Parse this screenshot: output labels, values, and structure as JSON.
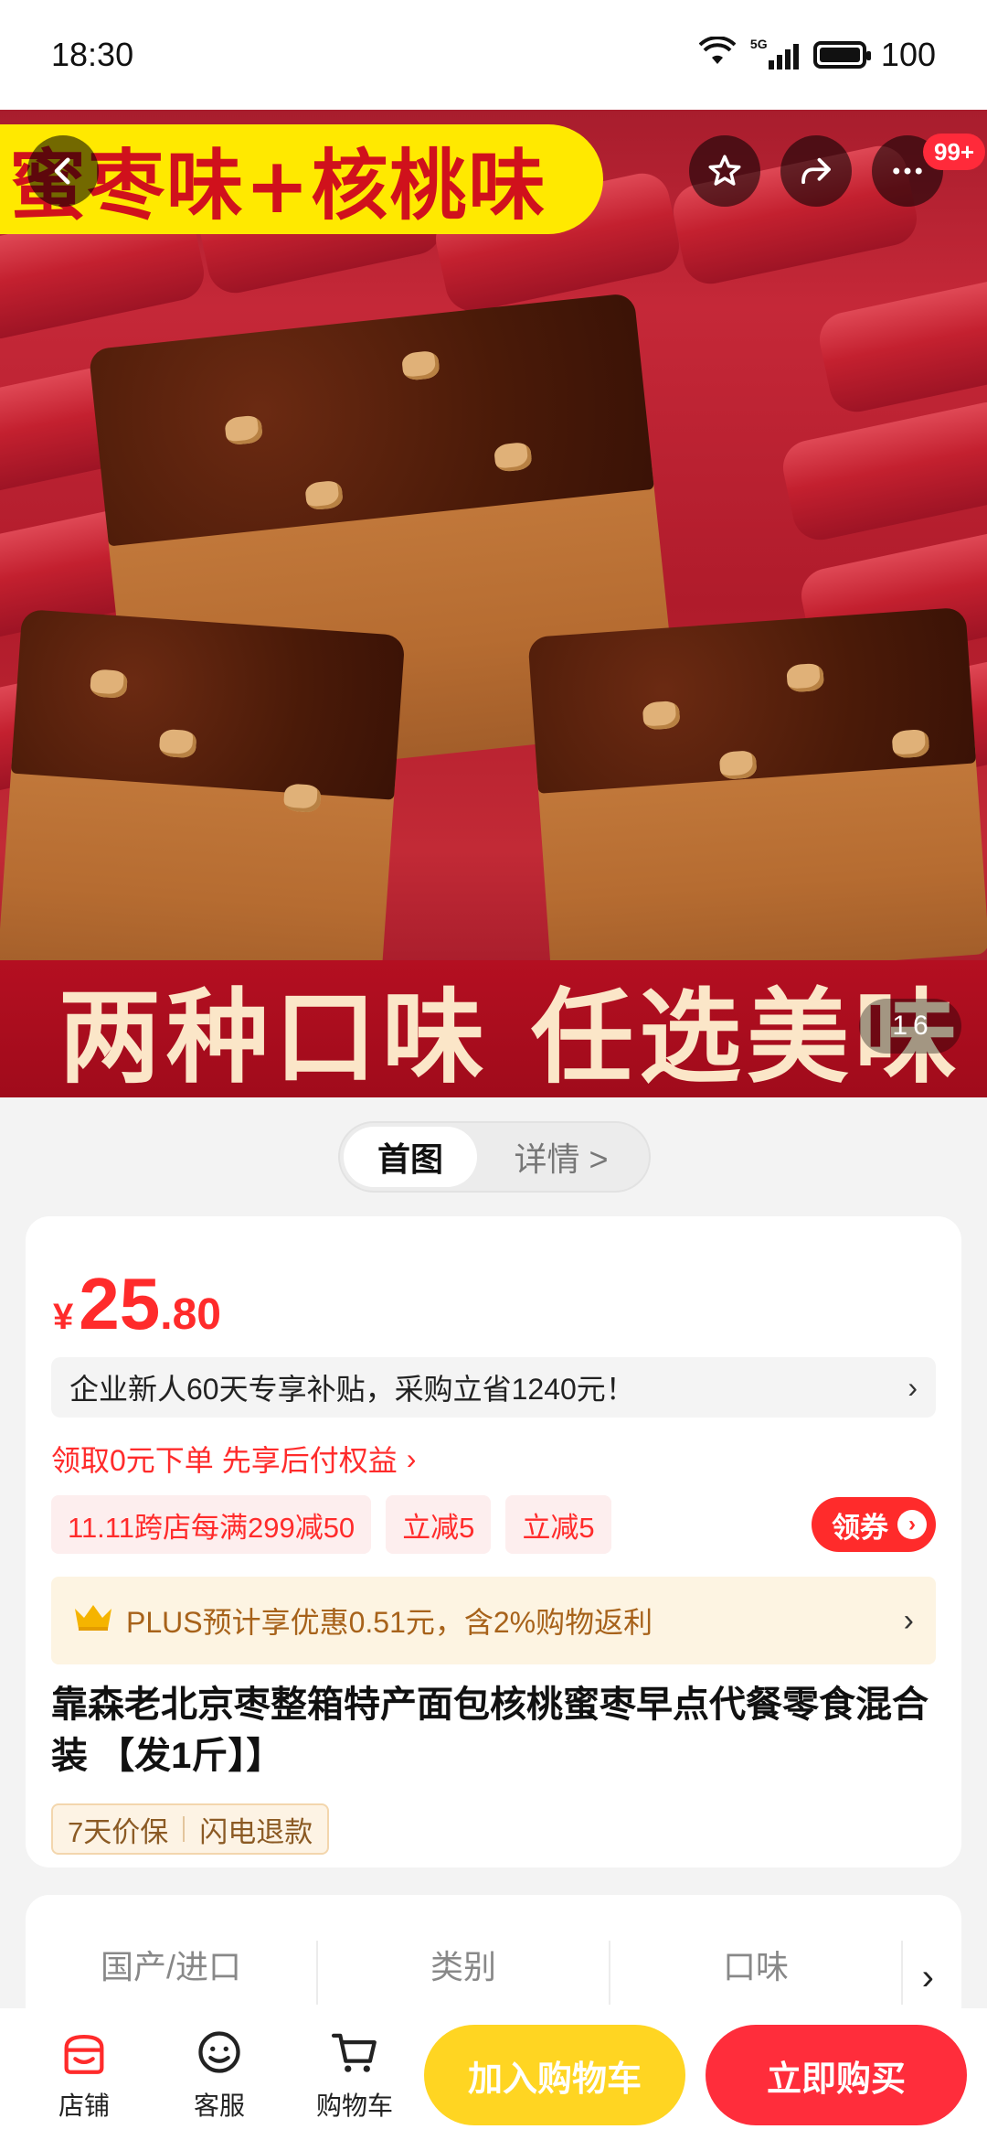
{
  "status": {
    "time": "18:30",
    "network": "5G",
    "battery": "100"
  },
  "hero": {
    "banner_top": "蜜枣味+核桃味",
    "banner_bottom": "两种口味  任选美味",
    "counter_current": "1",
    "counter_total": "6",
    "badge": "99+"
  },
  "tabs": [
    {
      "label": "首图"
    },
    {
      "label": "详情 >"
    }
  ],
  "product": {
    "currency": "¥",
    "price_int": "25",
    "price_dec": ".80",
    "subsidy_text": "企业新人60天专享补贴，采购立省1240元！",
    "subsidy_chevron": "›",
    "pay_later": "领取0元下单 先享后付权益",
    "pay_later_chevron": "›",
    "promos": [
      "11.11跨店每满299减50",
      "立减5",
      "立减5"
    ],
    "coupon_label": "领券",
    "coupon_dot": "›",
    "plus_text": "PLUS预计享优惠0.51元，含2%购物返利",
    "plus_chevron": "›",
    "title": "靠森老北京枣整箱特产面包核桃蜜枣早点代餐零食混合装 【发1斤】】",
    "guarantees": [
      "7天价保",
      "闪电退款"
    ]
  },
  "params": {
    "labels": [
      "国产/进口",
      "类别",
      "口味"
    ],
    "chevron": "›"
  },
  "bottom_nav": {
    "items": [
      {
        "label": "店铺"
      },
      {
        "label": "客服"
      },
      {
        "label": "购物车"
      }
    ],
    "add_to_cart": "加入购物车",
    "buy_now": "立即购买"
  },
  "colors": {
    "accent_red": "#ff2b2b",
    "cart_yellow": "#ffd522",
    "plus_gold": "#a7621a"
  },
  "icons": [
    "back-icon",
    "star-icon",
    "share-icon",
    "more-icon",
    "store-icon",
    "service-icon",
    "cart-icon",
    "crown-icon",
    "wifi-icon",
    "signal-icon",
    "battery-icon"
  ]
}
